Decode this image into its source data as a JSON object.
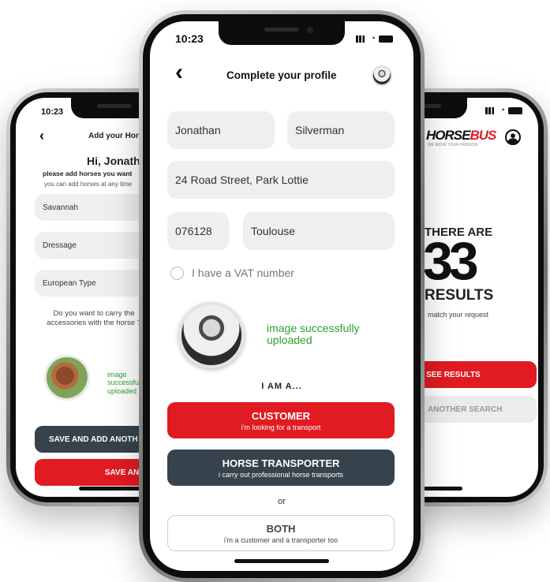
{
  "left_phone": {
    "time": "10:23",
    "header_title": "Add your Horse",
    "greeting": "Hi, Jonathan",
    "subtitle": "please add horses you want",
    "hint": "you can add horses at any time",
    "fields": [
      "Savannah",
      "Dressage",
      "European Type"
    ],
    "question": "Do you want to carry the accessories with the horse ?",
    "upload_status": "image successfully uploaded",
    "save_add_label": "SAVE AND ADD ANOTH",
    "save_close_label": "SAVE AND CLOS"
  },
  "center_phone": {
    "time": "10:23",
    "header_title": "Complete your profile",
    "first_name": "Jonathan",
    "last_name": "Silverman",
    "address": "24 Road Street, Park Lottie",
    "postcode": "076128",
    "city": "Toulouse",
    "vat_label": "I have a VAT number",
    "upload_status": "image successfully uploaded",
    "role_heading": "I AM A...",
    "customer_title": "CUSTOMER",
    "customer_sub": "i'm looking for a transport",
    "transporter_title": "HORSE TRANSPORTER",
    "transporter_sub": "i carry out professional horse transports",
    "or_label": "or",
    "both_title": "BOTH",
    "both_sub": "i'm a customer and a transporter too"
  },
  "right_phone": {
    "logo_text_a": "HORSE",
    "logo_text_b": "BUS",
    "logo_tagline": "WE MOVE YOUR PASSION",
    "there_are": "THERE ARE",
    "count": "33",
    "results": "RESULTS",
    "match_text": "match your request",
    "see_results_label": "SEE RESULTS",
    "another_search_label": "ANOTHER SEARCH"
  },
  "colors": {
    "accent_red": "#e11b22",
    "dark_button": "#36424c",
    "field_bg": "#efefef",
    "success_green": "#2ea02e"
  }
}
